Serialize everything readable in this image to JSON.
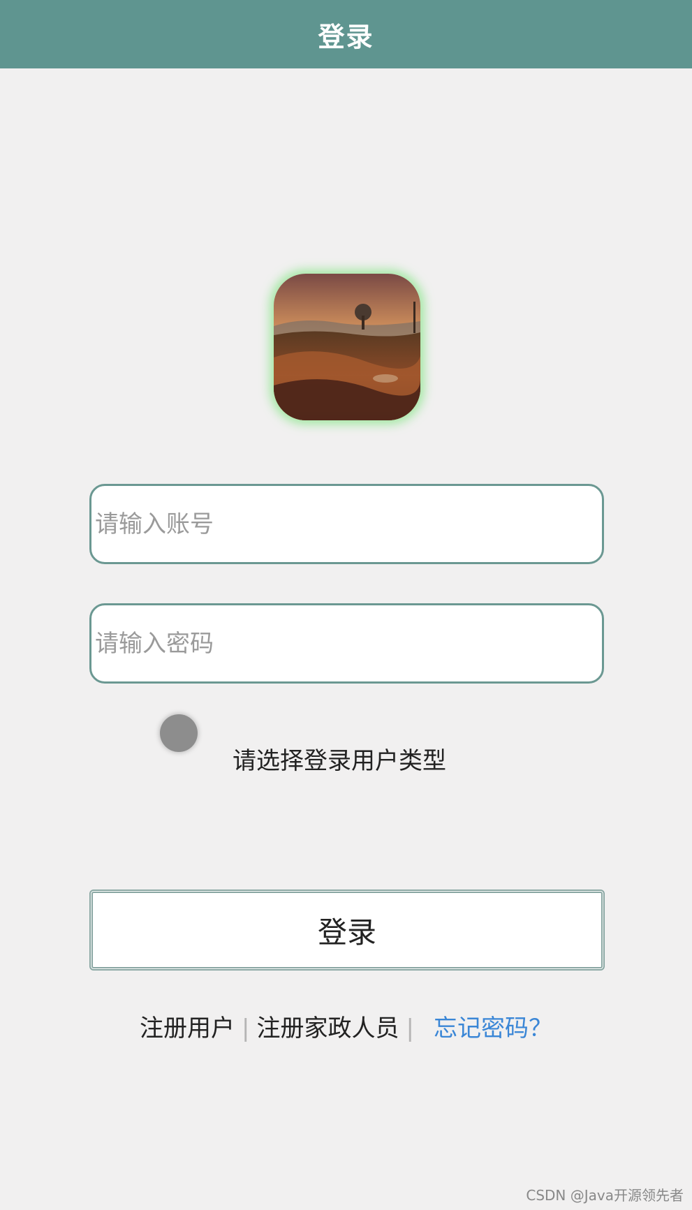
{
  "header": {
    "title": "登录"
  },
  "avatar": {
    "icon": "landscape-image"
  },
  "form": {
    "account_placeholder": "请输入账号",
    "password_placeholder": "请输入密码",
    "role_label": "请选择登录用户类型",
    "login_button": "登录"
  },
  "links": {
    "register_user": "注册用户",
    "separator": "|",
    "register_staff": "注册家政人员",
    "forgot_password": "忘记密码？"
  },
  "watermark": "CSDN @Java开源领先者",
  "colors": {
    "header_bg": "#5f9590",
    "field_border": "#6b9892",
    "link_accent": "#3a86d6",
    "page_bg": "#f1f0f0"
  }
}
